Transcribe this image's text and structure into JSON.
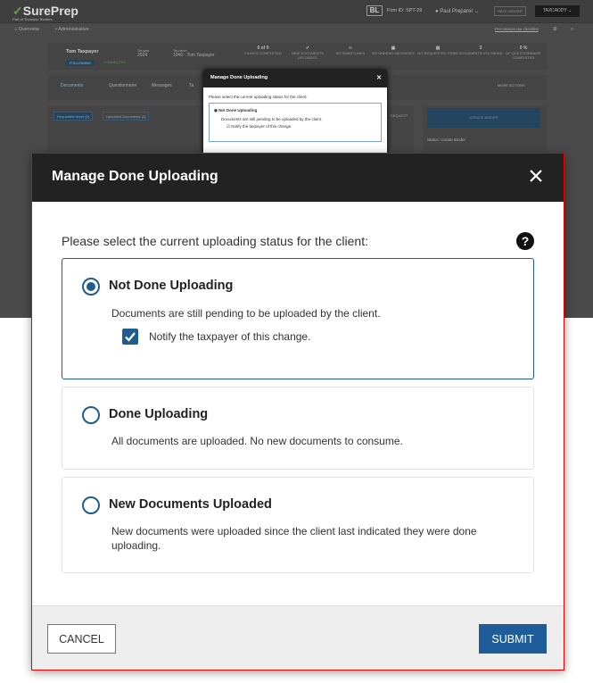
{
  "background": {
    "logo": "SurePrep",
    "logo_sub": "Part of Thomson Reuters",
    "firm_badge": "BL",
    "firm_id": "Firm ID: SPT-29",
    "user": "Paul Preparer",
    "help_center": "HELP CENTER",
    "taxcaddy": "TAXCADDY",
    "nav": [
      "Overview",
      "Administrative"
    ],
    "checklist_link": "Pre-season tax checklist",
    "client_name": "Tom Taxpayer",
    "following": "FOLLOWING",
    "connected": "CONNECTED",
    "tax_year_label": "Tax year",
    "tax_year": "2024",
    "tax_return_label": "Tax return",
    "tax_return": "1040 - Tom Taxpayer",
    "stats": [
      {
        "value": "0 of 0",
        "label": "FILINGS COMPLETED"
      },
      {
        "value": "✔",
        "label": "NEW DOCUMENTS UPLOADED"
      },
      {
        "value": "∞",
        "label": "NO SMARTLINKS"
      },
      {
        "value": "▣",
        "label": "NO UNREAD MESSAGES"
      },
      {
        "value": "▤",
        "label": "NO REQUESTED ITEMS"
      },
      {
        "value": "3",
        "label": "DOCUMENTS UPLOADED"
      },
      {
        "value": "0 %",
        "label": "OF QUESTIONNAIRE COMPLETED"
      }
    ],
    "tabs": [
      "Documents",
      "Questionnaire",
      "Messages",
      "Ta"
    ],
    "more_actions": "MORE ACTIONS",
    "requested_items": "Requested Items (0)",
    "uploaded_documents": "Uploaded Documents (2)",
    "request": "REQUEST",
    "create_binder": "CREATE BINDER",
    "status": "Status: Create Binder"
  },
  "modal": {
    "title": "Manage Done Uploading",
    "prompt": "Please select the current uploading status for the client:",
    "help_icon": "question-circle",
    "options": [
      {
        "title": "Not Done Uploading",
        "description": "Documents are still pending to be uploaded by the client.",
        "selected": true
      },
      {
        "title": "Done Uploading",
        "description": "All documents are uploaded. No new documents to consume.",
        "selected": false
      },
      {
        "title": "New Documents Uploaded",
        "description": "New documents were uploaded since the client last indicated they were done uploading.",
        "selected": false
      }
    ],
    "notify_label": "Notify the taxpayer of this change.",
    "notify_checked": true,
    "cancel": "CANCEL",
    "submit": "SUBMIT"
  },
  "colors": {
    "accent": "#1f5d8f",
    "highlight_border": "#e00000",
    "header": "#222222"
  }
}
